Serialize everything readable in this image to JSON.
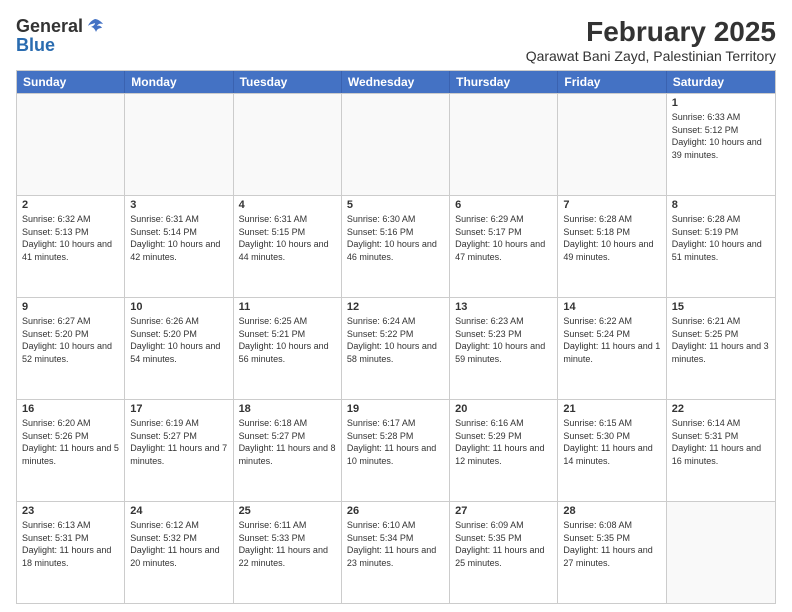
{
  "header": {
    "logo_general": "General",
    "logo_blue": "Blue",
    "title": "February 2025",
    "subtitle": "Qarawat Bani Zayd, Palestinian Territory"
  },
  "weekdays": [
    "Sunday",
    "Monday",
    "Tuesday",
    "Wednesday",
    "Thursday",
    "Friday",
    "Saturday"
  ],
  "rows": [
    [
      {
        "day": "",
        "info": "",
        "empty": true
      },
      {
        "day": "",
        "info": "",
        "empty": true
      },
      {
        "day": "",
        "info": "",
        "empty": true
      },
      {
        "day": "",
        "info": "",
        "empty": true
      },
      {
        "day": "",
        "info": "",
        "empty": true
      },
      {
        "day": "",
        "info": "",
        "empty": true
      },
      {
        "day": "1",
        "info": "Sunrise: 6:33 AM\nSunset: 5:12 PM\nDaylight: 10 hours and 39 minutes.",
        "empty": false
      }
    ],
    [
      {
        "day": "2",
        "info": "Sunrise: 6:32 AM\nSunset: 5:13 PM\nDaylight: 10 hours and 41 minutes.",
        "empty": false
      },
      {
        "day": "3",
        "info": "Sunrise: 6:31 AM\nSunset: 5:14 PM\nDaylight: 10 hours and 42 minutes.",
        "empty": false
      },
      {
        "day": "4",
        "info": "Sunrise: 6:31 AM\nSunset: 5:15 PM\nDaylight: 10 hours and 44 minutes.",
        "empty": false
      },
      {
        "day": "5",
        "info": "Sunrise: 6:30 AM\nSunset: 5:16 PM\nDaylight: 10 hours and 46 minutes.",
        "empty": false
      },
      {
        "day": "6",
        "info": "Sunrise: 6:29 AM\nSunset: 5:17 PM\nDaylight: 10 hours and 47 minutes.",
        "empty": false
      },
      {
        "day": "7",
        "info": "Sunrise: 6:28 AM\nSunset: 5:18 PM\nDaylight: 10 hours and 49 minutes.",
        "empty": false
      },
      {
        "day": "8",
        "info": "Sunrise: 6:28 AM\nSunset: 5:19 PM\nDaylight: 10 hours and 51 minutes.",
        "empty": false
      }
    ],
    [
      {
        "day": "9",
        "info": "Sunrise: 6:27 AM\nSunset: 5:20 PM\nDaylight: 10 hours and 52 minutes.",
        "empty": false
      },
      {
        "day": "10",
        "info": "Sunrise: 6:26 AM\nSunset: 5:20 PM\nDaylight: 10 hours and 54 minutes.",
        "empty": false
      },
      {
        "day": "11",
        "info": "Sunrise: 6:25 AM\nSunset: 5:21 PM\nDaylight: 10 hours and 56 minutes.",
        "empty": false
      },
      {
        "day": "12",
        "info": "Sunrise: 6:24 AM\nSunset: 5:22 PM\nDaylight: 10 hours and 58 minutes.",
        "empty": false
      },
      {
        "day": "13",
        "info": "Sunrise: 6:23 AM\nSunset: 5:23 PM\nDaylight: 10 hours and 59 minutes.",
        "empty": false
      },
      {
        "day": "14",
        "info": "Sunrise: 6:22 AM\nSunset: 5:24 PM\nDaylight: 11 hours and 1 minute.",
        "empty": false
      },
      {
        "day": "15",
        "info": "Sunrise: 6:21 AM\nSunset: 5:25 PM\nDaylight: 11 hours and 3 minutes.",
        "empty": false
      }
    ],
    [
      {
        "day": "16",
        "info": "Sunrise: 6:20 AM\nSunset: 5:26 PM\nDaylight: 11 hours and 5 minutes.",
        "empty": false
      },
      {
        "day": "17",
        "info": "Sunrise: 6:19 AM\nSunset: 5:27 PM\nDaylight: 11 hours and 7 minutes.",
        "empty": false
      },
      {
        "day": "18",
        "info": "Sunrise: 6:18 AM\nSunset: 5:27 PM\nDaylight: 11 hours and 8 minutes.",
        "empty": false
      },
      {
        "day": "19",
        "info": "Sunrise: 6:17 AM\nSunset: 5:28 PM\nDaylight: 11 hours and 10 minutes.",
        "empty": false
      },
      {
        "day": "20",
        "info": "Sunrise: 6:16 AM\nSunset: 5:29 PM\nDaylight: 11 hours and 12 minutes.",
        "empty": false
      },
      {
        "day": "21",
        "info": "Sunrise: 6:15 AM\nSunset: 5:30 PM\nDaylight: 11 hours and 14 minutes.",
        "empty": false
      },
      {
        "day": "22",
        "info": "Sunrise: 6:14 AM\nSunset: 5:31 PM\nDaylight: 11 hours and 16 minutes.",
        "empty": false
      }
    ],
    [
      {
        "day": "23",
        "info": "Sunrise: 6:13 AM\nSunset: 5:31 PM\nDaylight: 11 hours and 18 minutes.",
        "empty": false
      },
      {
        "day": "24",
        "info": "Sunrise: 6:12 AM\nSunset: 5:32 PM\nDaylight: 11 hours and 20 minutes.",
        "empty": false
      },
      {
        "day": "25",
        "info": "Sunrise: 6:11 AM\nSunset: 5:33 PM\nDaylight: 11 hours and 22 minutes.",
        "empty": false
      },
      {
        "day": "26",
        "info": "Sunrise: 6:10 AM\nSunset: 5:34 PM\nDaylight: 11 hours and 23 minutes.",
        "empty": false
      },
      {
        "day": "27",
        "info": "Sunrise: 6:09 AM\nSunset: 5:35 PM\nDaylight: 11 hours and 25 minutes.",
        "empty": false
      },
      {
        "day": "28",
        "info": "Sunrise: 6:08 AM\nSunset: 5:35 PM\nDaylight: 11 hours and 27 minutes.",
        "empty": false
      },
      {
        "day": "",
        "info": "",
        "empty": true
      }
    ]
  ]
}
